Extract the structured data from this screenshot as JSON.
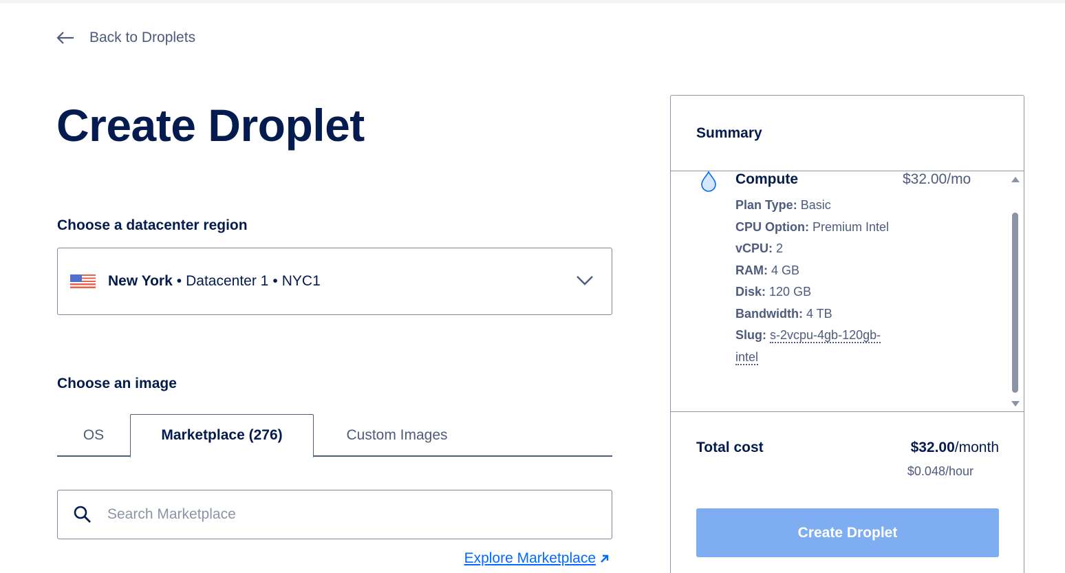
{
  "nav": {
    "back_label": "Back to Droplets"
  },
  "page": {
    "title": "Create Droplet"
  },
  "region": {
    "section_label": "Choose a datacenter region",
    "city": "New York",
    "datacenter": "Datacenter 1",
    "code": "NYC1",
    "separator": "•"
  },
  "image": {
    "section_label": "Choose an image",
    "tabs": [
      {
        "label": "OS",
        "active": false
      },
      {
        "label": "Marketplace (276)",
        "active": true
      },
      {
        "label": "Custom Images",
        "active": false
      }
    ],
    "search_placeholder": "Search Marketplace",
    "search_value": "",
    "explore_link": "Explore Marketplace"
  },
  "summary": {
    "title": "Summary",
    "compute": {
      "title": "Compute",
      "price": "$32.00/mo",
      "details": [
        {
          "key": "Plan Type:",
          "value": "Basic"
        },
        {
          "key": "CPU Option:",
          "value": "Premium Intel"
        },
        {
          "key": "vCPU:",
          "value": "2"
        },
        {
          "key": "RAM:",
          "value": "4 GB"
        },
        {
          "key": "Disk:",
          "value": "120 GB"
        },
        {
          "key": "Bandwidth:",
          "value": "4 TB"
        },
        {
          "key": "Slug:",
          "value": "s-2vcpu-4gb-120gb-intel"
        }
      ]
    },
    "total_label": "Total cost",
    "total_amount": "$32.00",
    "total_period": "/month",
    "total_hourly": "$0.048/hour",
    "create_button": "Create Droplet"
  },
  "colors": {
    "navy": "#031b4e",
    "muted": "#4d5b7c",
    "link": "#0069ff",
    "button_disabled": "#7fadf1"
  },
  "icons": [
    "arrow-left-icon",
    "us-flag-icon",
    "chevron-down-icon",
    "search-icon",
    "external-arrow-icon",
    "droplet-icon"
  ]
}
